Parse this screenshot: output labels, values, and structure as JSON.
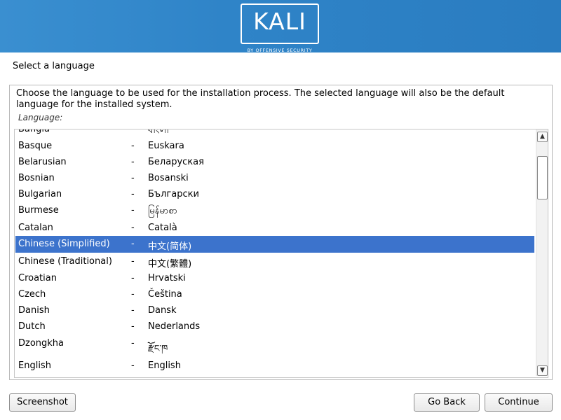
{
  "header": {
    "logo_text": "KALI",
    "logo_subtitle": "BY OFFENSIVE SECURITY",
    "background_color": "#2f84c8"
  },
  "page": {
    "title": "Select a language",
    "description": "Choose the language to be used for the installation process. The selected language will also be the default language for the installed system.",
    "field_label": "Language:"
  },
  "languages": [
    {
      "name": "Bangla",
      "separator": "-",
      "native": "বাংলা",
      "selected": false
    },
    {
      "name": "Basque",
      "separator": "-",
      "native": "Euskara",
      "selected": false
    },
    {
      "name": "Belarusian",
      "separator": "-",
      "native": "Беларуская",
      "selected": false
    },
    {
      "name": "Bosnian",
      "separator": "-",
      "native": "Bosanski",
      "selected": false
    },
    {
      "name": "Bulgarian",
      "separator": "-",
      "native": "Български",
      "selected": false
    },
    {
      "name": "Burmese",
      "separator": "-",
      "native": "မြန်မာစာ",
      "selected": false
    },
    {
      "name": "Catalan",
      "separator": "-",
      "native": "Català",
      "selected": false
    },
    {
      "name": "Chinese (Simplified)",
      "separator": "-",
      "native": "中文(简体)",
      "selected": true
    },
    {
      "name": "Chinese (Traditional)",
      "separator": "-",
      "native": "中文(繁體)",
      "selected": false
    },
    {
      "name": "Croatian",
      "separator": "-",
      "native": "Hrvatski",
      "selected": false
    },
    {
      "name": "Czech",
      "separator": "-",
      "native": "Čeština",
      "selected": false
    },
    {
      "name": "Danish",
      "separator": "-",
      "native": "Dansk",
      "selected": false
    },
    {
      "name": "Dutch",
      "separator": "-",
      "native": "Nederlands",
      "selected": false
    },
    {
      "name": "Dzongkha",
      "separator": "-",
      "native": "རྫོང་ཁ",
      "selected": false
    },
    {
      "name": "English",
      "separator": "-",
      "native": "English",
      "selected": false
    }
  ],
  "scrollbar": {
    "up_icon": "▲",
    "down_icon": "▼"
  },
  "buttons": {
    "screenshot": "Screenshot",
    "go_back": "Go Back",
    "continue": "Continue"
  },
  "colors": {
    "selection": "#3c73cc",
    "selection_text": "#ffffff"
  }
}
